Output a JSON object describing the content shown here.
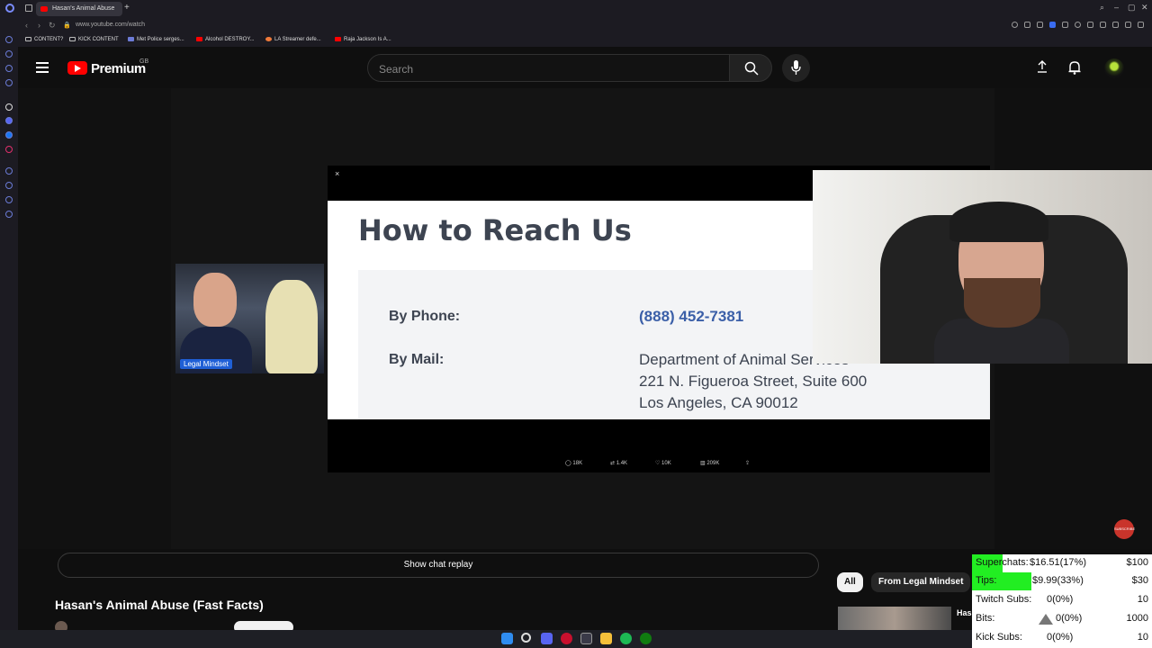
{
  "browser": {
    "tab_title": "Hasan's Animal Abuse",
    "new_tab": "+",
    "url": "www.youtube.com/watch",
    "bookmarks": [
      "CONTENT?",
      "KICK CONTENT",
      "Met Police serges...",
      "Alcohol DESTROY...",
      "LA Streamer defe...",
      "Raja Jackson Is A..."
    ]
  },
  "youtube": {
    "brand": "Premium",
    "region": "GB",
    "search_placeholder": "Search"
  },
  "video_frame": {
    "close": "×",
    "heading": "How to Reach Us",
    "phone_label": "By Phone:",
    "phone_value": "(888) 452-7381",
    "mail_label": "By Mail:",
    "mail_line1": "Department of Animal Services",
    "mail_line2": "221 N. Figueroa Street, Suite 600",
    "mail_line3": "Los Angeles, CA 90012",
    "stats": [
      "18K",
      "1.4K",
      "10K",
      "209K"
    ]
  },
  "cam_small": {
    "tag": "Legal Mindset"
  },
  "below": {
    "chat_replay": "Show chat replay",
    "video_title": "Hasan's Animal Abuse (Fast Facts)",
    "chip_all": "All",
    "chip_channel": "From Legal Mindset",
    "side_title_partial": "Has"
  },
  "subscribe_bubble": "SUBSCRIBE",
  "goals": {
    "accent": "#22ee22",
    "rows": [
      {
        "label": "Superchats:",
        "value": "$16.51(17%)",
        "target": "$100",
        "fraction": 0.17
      },
      {
        "label": "Tips:",
        "value": "$9.99(33%)",
        "target": "$30",
        "fraction": 0.33
      },
      {
        "label": "Twitch Subs:",
        "value": "0(0%)",
        "target": "10",
        "fraction": 0
      },
      {
        "label": "Bits:",
        "value": "0(0%)",
        "target": "1000",
        "fraction": 0
      },
      {
        "label": "Kick Subs:",
        "value": "0(0%)",
        "target": "10",
        "fraction": 0
      }
    ]
  },
  "icons": {
    "menu": "hamburger-menu-icon",
    "search": "search-icon",
    "mic": "mic-icon",
    "upload": "upload-icon",
    "bell": "bell-icon"
  }
}
